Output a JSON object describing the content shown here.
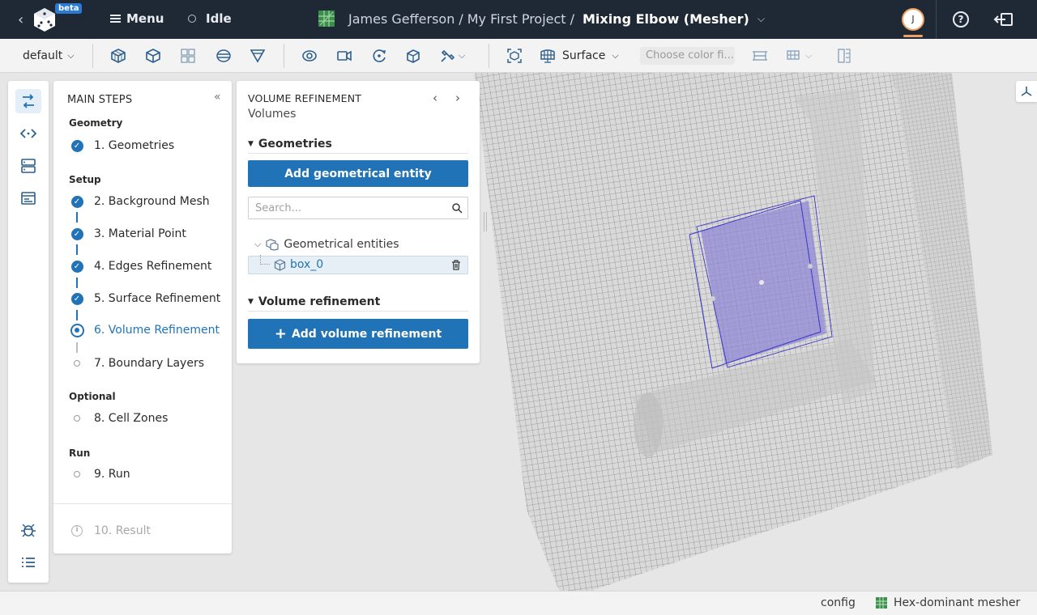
{
  "topbar": {
    "beta_label": "beta",
    "menu_label": "Menu",
    "status_label": "Idle",
    "breadcrumb": {
      "user": "James Gefferson",
      "separator": "/",
      "project": "My First Project",
      "current": "Mixing Elbow (Mesher)"
    },
    "user_initial": "J",
    "help_label": "?",
    "colors": {
      "bg": "#1f2935",
      "avatar_ring": "#f0a060",
      "beta": "#2b7bd6"
    }
  },
  "toolbar": {
    "preset": "default",
    "render_mode": "Surface",
    "color_field_placeholder": "Choose color fi..."
  },
  "rail": {
    "icons": [
      "workflow-icon",
      "code-icon",
      "server-icon",
      "terminal-icon",
      "bug-icon",
      "list-icon"
    ]
  },
  "steps": {
    "title": "MAIN STEPS",
    "collapse_glyph": "«",
    "groups": {
      "geometry": "Geometry",
      "setup": "Setup",
      "optional": "Optional",
      "run": "Run"
    },
    "items": [
      {
        "label": "1. Geometries",
        "state": "done"
      },
      {
        "label": "2. Background Mesh",
        "state": "done"
      },
      {
        "label": "3. Material Point",
        "state": "done"
      },
      {
        "label": "4. Edges Refinement",
        "state": "done"
      },
      {
        "label": "5. Surface Refinement",
        "state": "done"
      },
      {
        "label": "6. Volume Refinement",
        "state": "current"
      },
      {
        "label": "7. Boundary Layers",
        "state": "todo"
      },
      {
        "label": "8. Cell Zones",
        "state": "todo"
      },
      {
        "label": "9. Run",
        "state": "todo"
      },
      {
        "label": "10. Result",
        "state": "disabled"
      }
    ],
    "check_glyph": "✓",
    "info_glyph": "i",
    "accent": "#2173b8"
  },
  "volume_panel": {
    "title": "VOLUME REFINEMENT",
    "subtitle": "Volumes",
    "prev_glyph": "‹",
    "next_glyph": "›",
    "geometries_heading": "Geometries",
    "add_geometry_button": "Add geometrical entity",
    "search_placeholder": "Search...",
    "tree_root": "Geometrical entities",
    "tree_items": [
      "box_0"
    ],
    "volume_heading": "Volume refinement",
    "add_volume_button": "Add volume refinement",
    "add_glyph": "+",
    "collapse_glyph": "▼",
    "tree_chevron": "⌵"
  },
  "footer": {
    "config": "config",
    "mesher": "Hex-dominant mesher"
  }
}
